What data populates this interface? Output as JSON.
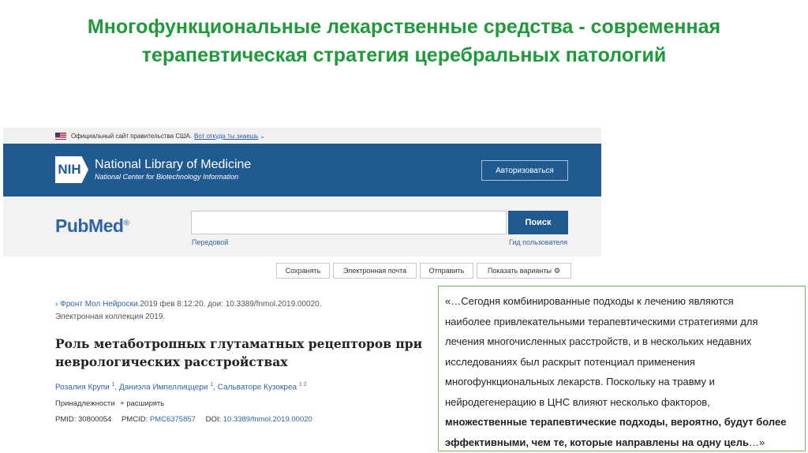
{
  "slide": {
    "title_line1": "Многофункциональные лекарственные средства - современная",
    "title_line2": "терапевтическая стратегия церебральных патологий",
    "title_color": "#1f9a3b"
  },
  "gov_banner": {
    "text": "Официальный сайт правительства США.",
    "link": "Вот откуда ты знаешь"
  },
  "nih": {
    "logo": "NIH",
    "name": "National Library of Medicine",
    "sub": "National Center for Biotechnology Information",
    "login": "Авторизоваться",
    "bar_color": "#215a91"
  },
  "pubmed": {
    "logo": "PubMed",
    "logo_mark": "®",
    "search_value": "",
    "search_button": "Поиск",
    "advanced": "Передовой",
    "user_guide": "Гид пользователя"
  },
  "actions": [
    "Сохранять",
    "Электронная почта",
    "Отправить",
    "Показать варианты"
  ],
  "article": {
    "journal": "Фронт Мол Нейроски.",
    "citation": "2019 фев 8:12:20. дои: 10.3389/fnmol.2019.00020.",
    "collection": "Электронная коллекция 2019.",
    "title": "Роль метаботропных глутаматных рецепторов при неврологических расстройствах",
    "authors": [
      {
        "name": "Розалия Крупи",
        "sup": "1"
      },
      {
        "name": "Даниэла Импеллиццери",
        "sup": "1"
      },
      {
        "name": "Сальваторе Кузокреа",
        "sup": "1 2"
      }
    ],
    "affiliations": "Принадлежности",
    "expand": "+ расширять",
    "pmid_label": "PMID: 30800054",
    "pmcid_label": "PMCID:",
    "pmcid": "PMC6375857",
    "doi_label": "DOI:",
    "doi": "10.3389/fnmol.2019.00020"
  },
  "quote": {
    "lines": [
      "«…Сегодня комбинированные подходы к лечению являются",
      "наиболее привлекательными терапевтическими стратегиями для",
      "лечения многочисленных расстройств, и в нескольких недавних",
      "исследованиях был  раскрыт потенциал применения",
      "многофункциональных лекарств. Поскольку на травму и",
      "нейродегенерацию в ЦНС влияют несколько факторов,"
    ],
    "bold_line1": "множественные терапевтические подходы, вероятно, будут более",
    "bold_line2": "эффективными, чем те, которые направлены на одну цель",
    "closing": "…»",
    "border_color": "#7ab55c"
  }
}
